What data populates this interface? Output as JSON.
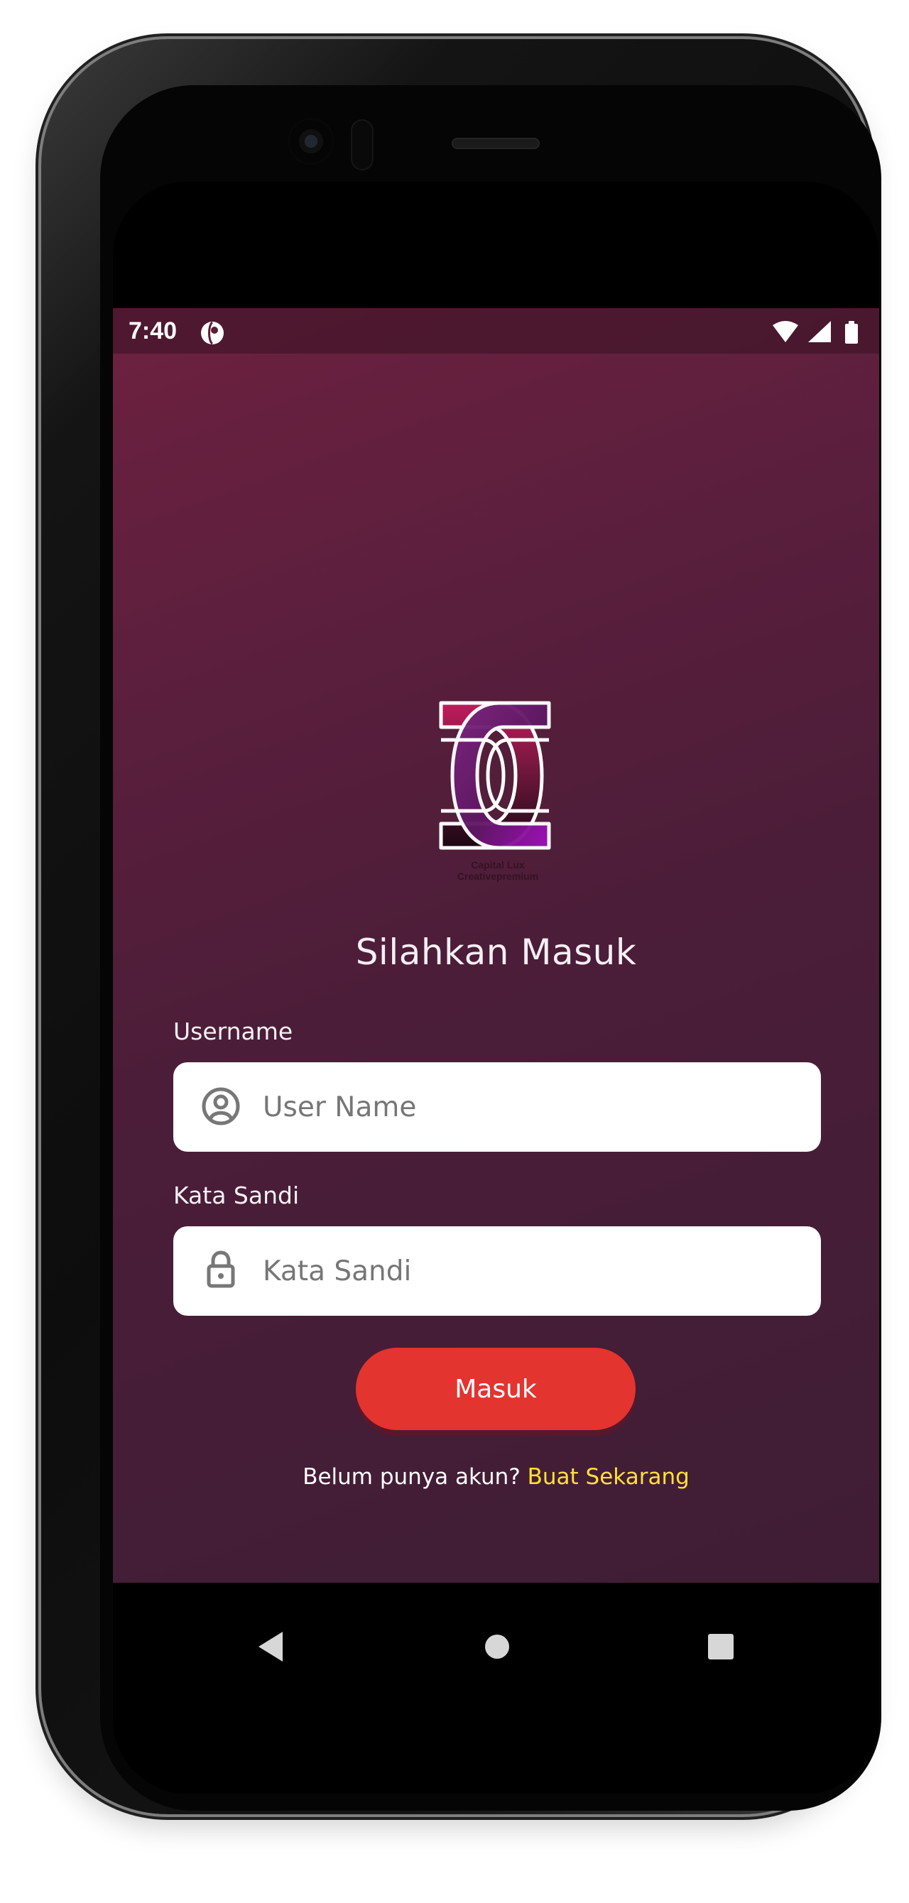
{
  "status_bar": {
    "time": "7:40",
    "icons": [
      "app-status-icon",
      "wifi-icon",
      "signal-icon",
      "battery-icon"
    ]
  },
  "app": {
    "logo_caption_lines": [
      "Capital Lux",
      "Creativepremium"
    ],
    "title": "Silahkan Masuk",
    "username_label": "Username",
    "username_placeholder": "User Name",
    "password_label": "Kata Sandi",
    "password_placeholder": "Kata Sandi",
    "submit_label": "Masuk",
    "register_prompt": "Belum punya akun?",
    "register_link": "Buat Sekarang"
  },
  "navigation": {
    "icons": [
      "back-icon",
      "home-icon",
      "recent-apps-icon"
    ]
  },
  "colors": {
    "background_top": "#6e2140",
    "background_bottom": "#3f1d35",
    "button_red": "#e3342f",
    "link_yellow": "#ffe135",
    "input_white": "#ffffff"
  }
}
